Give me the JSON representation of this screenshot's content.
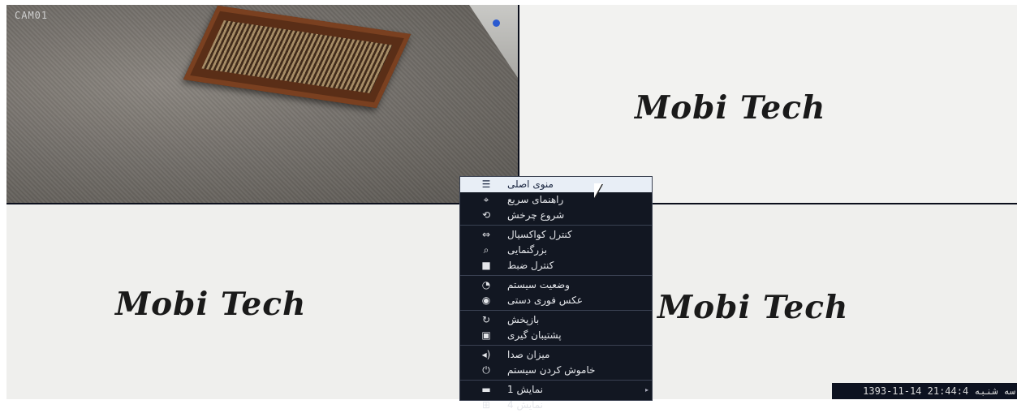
{
  "camera_label": "CAM01",
  "brand_text": "Mobi Tech",
  "menu": {
    "groups": [
      [
        {
          "icon": "☰",
          "label": "منوی اصلی",
          "active": true
        },
        {
          "icon": "⌖",
          "label": "راهنمای سریع"
        },
        {
          "icon": "⟲",
          "label": "شروع چرخش"
        }
      ],
      [
        {
          "icon": "⇔",
          "label": "کنترل کواکسیال"
        },
        {
          "icon": "⌕",
          "label": "بزرگنمایی"
        },
        {
          "icon": "■",
          "label": "کنترل ضبط"
        }
      ],
      [
        {
          "icon": "◔",
          "label": "وضعیت سیستم"
        },
        {
          "icon": "◉",
          "label": "عکس فوری دستی"
        }
      ],
      [
        {
          "icon": "↻",
          "label": "بازپخش"
        },
        {
          "icon": "▣",
          "label": "پشتیبان گیری"
        }
      ],
      [
        {
          "icon": "◂)",
          "label": "میزان صدا"
        },
        {
          "icon": "⏻",
          "label": "خاموش کردن سیستم"
        }
      ],
      [
        {
          "icon": "▬",
          "label": "1 نمایش",
          "submenu": true
        },
        {
          "icon": "⊞",
          "label": "4 نمایش"
        }
      ]
    ]
  },
  "datetime": "1393-11-14 سه شنبه 21:44:4"
}
